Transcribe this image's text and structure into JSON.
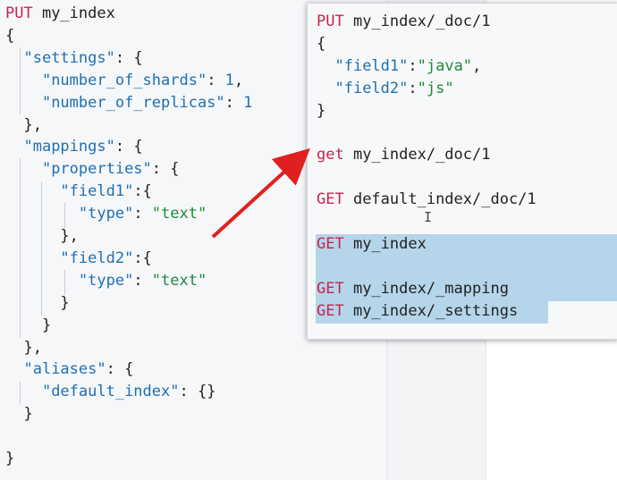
{
  "left_editor": {
    "lines": [
      {
        "method": "PUT",
        "path": " my_index"
      },
      {
        "text": "{"
      },
      {
        "indent": "  ",
        "key": "\"settings\"",
        "rest": ": {"
      },
      {
        "indent": "    ",
        "key": "\"number_of_shards\"",
        "rest": ": ",
        "num": "1",
        "tail": ","
      },
      {
        "indent": "    ",
        "key": "\"number_of_replicas\"",
        "rest": ": ",
        "num": "1",
        "tail": ""
      },
      {
        "text": "  },"
      },
      {
        "indent": "  ",
        "key": "\"mappings\"",
        "rest": ": {"
      },
      {
        "indent": "    ",
        "key": "\"properties\"",
        "rest": ": {"
      },
      {
        "indent": "      ",
        "key": "\"field1\"",
        "rest": ":{"
      },
      {
        "indent": "        ",
        "key": "\"type\"",
        "rest": ": ",
        "str": "\"text\""
      },
      {
        "text": "      },"
      },
      {
        "indent": "      ",
        "key": "\"field2\"",
        "rest": ":{"
      },
      {
        "indent": "        ",
        "key": "\"type\"",
        "rest": ": ",
        "str": "\"text\""
      },
      {
        "text": "      }"
      },
      {
        "text": "    }"
      },
      {
        "text": "  },"
      },
      {
        "indent": "  ",
        "key": "\"aliases\"",
        "rest": ": {"
      },
      {
        "indent": "    ",
        "key": "\"default_index\"",
        "rest": ": {}"
      },
      {
        "text": "  }"
      },
      {
        "text": ""
      },
      {
        "text": "}"
      }
    ]
  },
  "overlay_editor": {
    "lines": [
      {
        "method": "PUT",
        "path": " my_index/_doc/1"
      },
      {
        "text": "{"
      },
      {
        "indent": "  ",
        "key": "\"field1\"",
        "rest": ":",
        "str": "\"java\"",
        "tail": ","
      },
      {
        "indent": "  ",
        "key": "\"field2\"",
        "rest": ":",
        "str": "\"js\"",
        "tail": ""
      },
      {
        "text": "}"
      },
      {
        "text": ""
      },
      {
        "method": "get",
        "path": " my_index/_doc/1"
      },
      {
        "text": ""
      },
      {
        "method": "GET",
        "path": " default_index/_doc/1"
      },
      {
        "text": ""
      },
      {
        "method": "GET",
        "path": " my_index"
      },
      {
        "text": ""
      },
      {
        "method": "GET",
        "path": " my_index/_mapping"
      },
      {
        "method": "GET",
        "path": " my_index/_settings"
      }
    ]
  },
  "colors": {
    "method": "#c7254e",
    "key": "#1f6fb2",
    "string": "#1f8a3c",
    "selection": "#b4d5ea",
    "arrow": "#e02020"
  }
}
